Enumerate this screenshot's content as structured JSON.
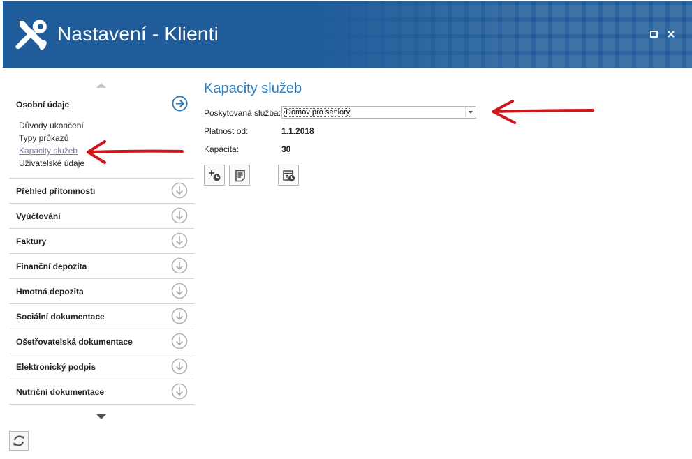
{
  "window": {
    "title": "Nastavení - Klienti",
    "icons": {
      "app": "wrench-screwdriver-icon",
      "maximize": "maximize-icon",
      "close": "close-icon"
    }
  },
  "sidebar": {
    "active_section": {
      "label": "Osobní údaje",
      "icon": "arrow-right-circle-icon",
      "items": [
        {
          "label": "Důvody ukončení"
        },
        {
          "label": "Typy průkazů"
        },
        {
          "label": "Kapacity služeb",
          "selected": true
        },
        {
          "label": "Uživatelské údaje"
        }
      ]
    },
    "sections": [
      {
        "label": "Přehled přítomnosti"
      },
      {
        "label": "Vyúčtování"
      },
      {
        "label": "Faktury"
      },
      {
        "label": "Finanční depozita"
      },
      {
        "label": "Hmotná depozita"
      },
      {
        "label": "Sociální dokumentace"
      },
      {
        "label": "Ošetřovatelská dokumentace"
      },
      {
        "label": "Elektronický podpis"
      },
      {
        "label": "Nutriční dokumentace"
      }
    ],
    "section_icon": "arrow-down-circle-icon",
    "refresh_icon": "refresh-icon"
  },
  "main": {
    "title": "Kapacity služeb",
    "service_label": "Poskytovaná služba:",
    "service_value": "Domov pro seniory",
    "valid_from_label": "Platnost od:",
    "valid_from_value": "1.1.2018",
    "capacity_label": "Kapacita:",
    "capacity_value": "30",
    "toolbar_icons": [
      "add-time-icon",
      "document-list-icon",
      "calendar-history-icon"
    ]
  },
  "colors": {
    "header_bg": "#1f5c99",
    "title_blue": "#2c7ab8",
    "annotation_red": "#d0151b",
    "active_icon": "#2c7ab8"
  }
}
